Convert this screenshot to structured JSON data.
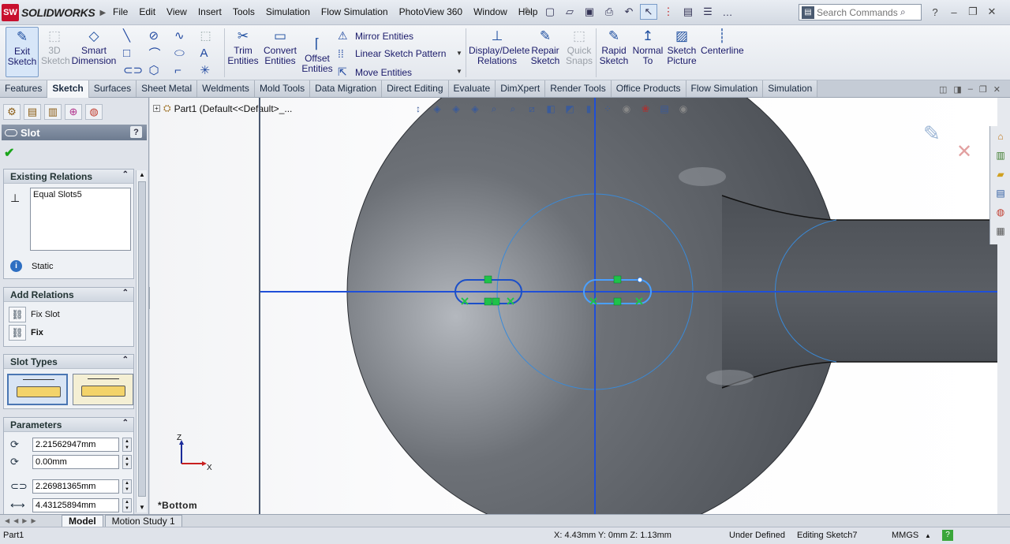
{
  "app": {
    "brand": "SOLIDWORKS",
    "logo_letters": "SW"
  },
  "menu": [
    "File",
    "Edit",
    "View",
    "Insert",
    "Tools",
    "Simulation",
    "Flow Simulation",
    "PhotoView 360",
    "Window",
    "Help"
  ],
  "search": {
    "placeholder": "Search Commands"
  },
  "commands": {
    "exit_sketch": "Exit Sketch",
    "sketch_3d": "3D Sketch",
    "smart_dimension": "Smart Dimension",
    "trim_entities": "Trim Entities",
    "convert_entities": "Convert Entities",
    "offset_entities": "Offset Entities",
    "mirror_entities": "Mirror Entities",
    "linear_sketch_pattern": "Linear Sketch Pattern",
    "move_entities": "Move Entities",
    "display_delete_relations": "Display/Delete Relations",
    "repair_sketch": "Repair Sketch",
    "quick_snaps": "Quick Snaps",
    "rapid_sketch": "Rapid Sketch",
    "normal_to": "Normal To",
    "sketch_picture": "Sketch Picture",
    "centerline": "Centerline"
  },
  "tabs": [
    "Features",
    "Sketch",
    "Surfaces",
    "Sheet Metal",
    "Weldments",
    "Mold Tools",
    "Data Migration",
    "Direct Editing",
    "Evaluate",
    "DimXpert",
    "Render Tools",
    "Office Products",
    "Flow Simulation",
    "Simulation"
  ],
  "active_tab": "Sketch",
  "property_manager": {
    "title": "Slot",
    "help": "?",
    "existing_relations": {
      "header": "Existing Relations",
      "items": [
        "Equal Slots5"
      ],
      "status": "Static"
    },
    "add_relations": {
      "header": "Add Relations",
      "items": [
        "Fix Slot",
        "Fix"
      ]
    },
    "slot_types": {
      "header": "Slot Types"
    },
    "parameters": {
      "header": "Parameters",
      "x": "2.21562947mm",
      "y": "0.00mm",
      "length": "2.26981365mm",
      "width": "4.43125894mm"
    }
  },
  "feature_tree": {
    "root": "Part1  (Default<<Default>_..."
  },
  "viewport": {
    "view_name": "*Bottom",
    "triad_z": "Z",
    "triad_x": "X"
  },
  "bottom_tabs": [
    "Model",
    "Motion Study 1"
  ],
  "status": {
    "doc": "Part1",
    "coords": "X: 4.43mm Y: 0mm Z: 1.13mm",
    "definition": "Under Defined",
    "editing": "Editing Sketch7",
    "units": "MMGS",
    "units_arrow": "▲"
  },
  "colors": {
    "accent": "#1f4fa0",
    "sketch_blue": "#2563c9",
    "relation_green": "#1fc24a",
    "model_gray": "#55595f"
  }
}
